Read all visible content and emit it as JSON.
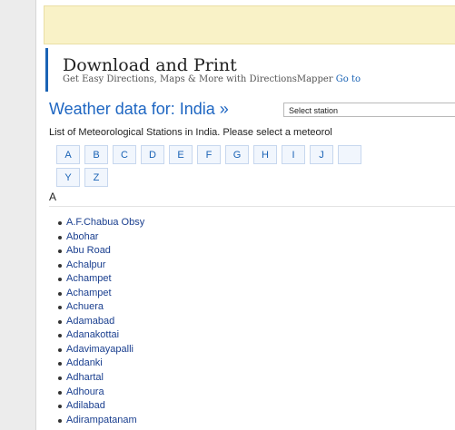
{
  "ad": {
    "title": "Download and Print",
    "subtitle": "Get Easy Directions, Maps & More with DirectionsMapper",
    "link": "Go to"
  },
  "weather": {
    "title": "Weather data for: India »",
    "select_value": "Select station"
  },
  "intro": "List of Meteorological Stations in India. Please select a meteorol",
  "letters": [
    "A",
    "B",
    "C",
    "D",
    "E",
    "F",
    "G",
    "H",
    "I",
    "J",
    "Y",
    "Z"
  ],
  "section_letter": "A",
  "stations": [
    "A.F.Chabua Obsy",
    "Abohar",
    "Abu Road",
    "Achalpur",
    "Achampet",
    "Achampet",
    "Achuera",
    "Adamabad",
    "Adanakottai",
    "Adavimayapalli",
    "Addanki",
    "Adhartal",
    "Adhoura",
    "Adilabad",
    "Adirampatanam"
  ],
  "colors": {
    "link": "#1a63b5",
    "title_blue": "#1e66c2",
    "ad_bar": "#f9f2c7",
    "gutter": "#ececec"
  }
}
